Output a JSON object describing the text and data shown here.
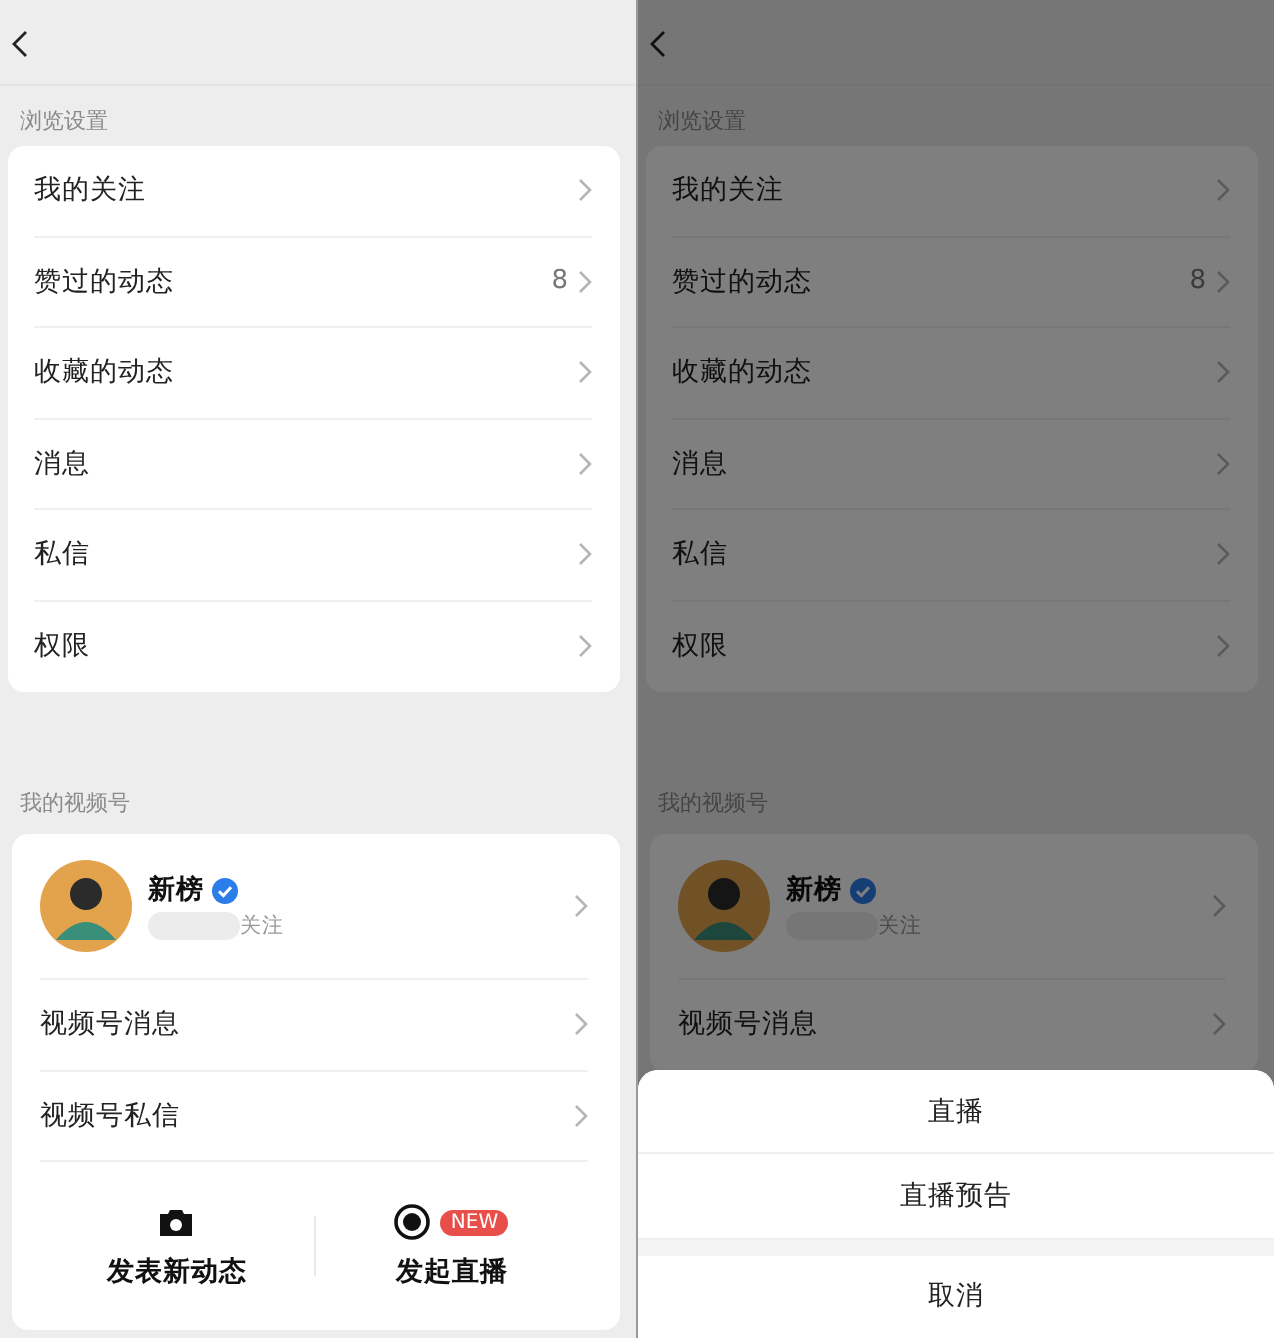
{
  "screens": [
    {
      "dimmed": false,
      "sections": [
        {
          "title": "浏览设置",
          "items": [
            {
              "label": "我的关注"
            },
            {
              "label": "赞过的动态",
              "count": "8"
            },
            {
              "label": "收藏的动态"
            },
            {
              "label": "消息"
            },
            {
              "label": "私信"
            },
            {
              "label": "权限"
            }
          ]
        }
      ],
      "channel": {
        "title": "我的视频号",
        "profile": {
          "name": "新榜",
          "verified": true,
          "follow_label": "关注"
        },
        "items": [
          {
            "label": "视频号消息"
          },
          {
            "label": "视频号私信"
          }
        ],
        "actions": [
          {
            "kind": "camera",
            "label": "发表新动态"
          },
          {
            "kind": "live",
            "label": "发起直播",
            "badge": "NEW"
          }
        ]
      }
    },
    {
      "dimmed": true,
      "sections": [
        {
          "title": "浏览设置",
          "items": [
            {
              "label": "我的关注"
            },
            {
              "label": "赞过的动态",
              "count": "8"
            },
            {
              "label": "收藏的动态"
            },
            {
              "label": "消息"
            },
            {
              "label": "私信"
            },
            {
              "label": "权限"
            }
          ]
        }
      ],
      "channel": {
        "title": "我的视频号",
        "profile": {
          "name": "新榜",
          "verified": true,
          "follow_label": "关注"
        },
        "items": [
          {
            "label": "视频号消息"
          }
        ]
      },
      "action_sheet": {
        "options": [
          "直播",
          "直播预告"
        ],
        "cancel": "取消"
      }
    }
  ]
}
